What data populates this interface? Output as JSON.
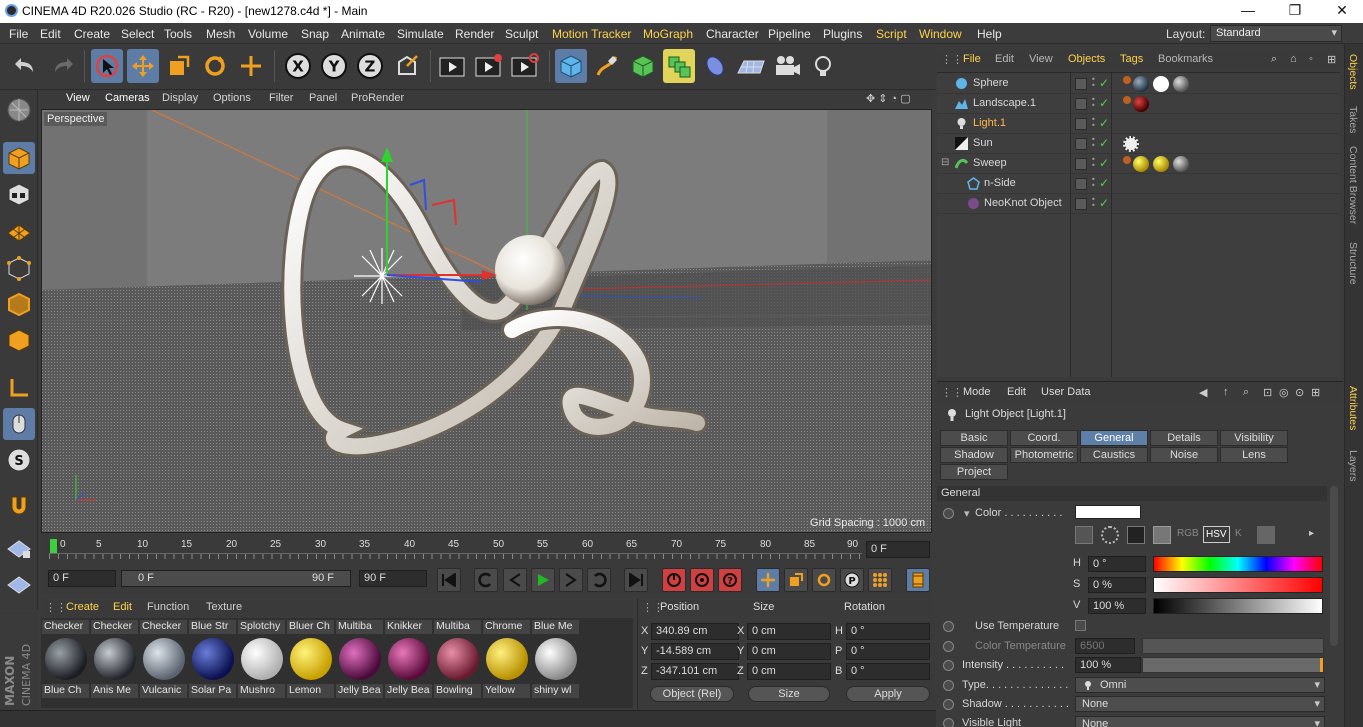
{
  "window": {
    "title": "CINEMA 4D R20.026 Studio (RC - R20) - [new1278.c4d *] - Main",
    "minimize": "—",
    "restore": "❐",
    "close": "✕"
  },
  "menubar": {
    "items": [
      "File",
      "Edit",
      "Create",
      "Select",
      "Tools",
      "Mesh",
      "Volume",
      "Snap",
      "Animate",
      "Simulate",
      "Render",
      "Sculpt",
      "Motion Tracker",
      "MoGraph",
      "Character",
      "Pipeline",
      "Plugins",
      "Script",
      "Window",
      "Help"
    ],
    "layout_label": "Layout:",
    "layout_value": "Standard"
  },
  "viewport": {
    "menu": [
      "View",
      "Cameras",
      "Display",
      "Options",
      "Filter",
      "Panel",
      "ProRender"
    ],
    "camera_label": "Perspective",
    "grid_spacing": "Grid Spacing : 1000 cm"
  },
  "timeline": {
    "ticks": [
      "0",
      "5",
      "10",
      "15",
      "20",
      "25",
      "30",
      "35",
      "40",
      "45",
      "50",
      "55",
      "60",
      "65",
      "70",
      "75",
      "80",
      "85",
      "90"
    ],
    "current_frame": "0 F"
  },
  "transport": {
    "start": "0 F",
    "range_start": "0 F",
    "range_end": "90 F",
    "end": "90 F"
  },
  "material_manager": {
    "menu": [
      "Create",
      "Edit",
      "Function",
      "Texture"
    ],
    "row1": [
      "Checker",
      "Checker",
      "Checker",
      "Blue Str",
      "Splotchy",
      "Bluer Ch",
      "Multiba",
      "Knikker",
      "Multiba",
      "Chrome",
      "Blue Me"
    ],
    "row2": [
      "Blue Ch",
      "Anis Me",
      "Vulcanic",
      "Solar Pa",
      "Mushro",
      "Lemon",
      "Jelly Bea",
      "Jelly Bea",
      "Bowling",
      "Yellow",
      "shiny wl"
    ]
  },
  "coordinates": {
    "headers": [
      "Position",
      "Size",
      "Rotation"
    ],
    "position": {
      "x": "340.89 cm",
      "y": "-14.589 cm",
      "z": "-347.101 cm"
    },
    "size": {
      "x": "0 cm",
      "y": "0 cm",
      "z": "0 cm"
    },
    "rotation": {
      "h": "0 °",
      "p": "0 °",
      "b": "0 °"
    },
    "axis_labels": {
      "x": "X",
      "y": "Y",
      "z": "Z",
      "h": "H",
      "p": "P",
      "b": "B"
    },
    "mode": "Object (Rel)",
    "size_mode": "Size",
    "apply": "Apply"
  },
  "object_manager": {
    "menu": [
      "File",
      "Edit",
      "View",
      "Objects",
      "Tags",
      "Bookmarks"
    ],
    "objects": [
      {
        "name": "Sphere"
      },
      {
        "name": "Landscape.1"
      },
      {
        "name": "Light.1"
      },
      {
        "name": "Sun"
      },
      {
        "name": "Sweep"
      },
      {
        "name": "n-Side"
      },
      {
        "name": "NeoKnot Object"
      }
    ]
  },
  "attributes": {
    "menu": [
      "Mode",
      "Edit",
      "User Data"
    ],
    "title": "Light Object [Light.1]",
    "tabs_row1": [
      "Basic",
      "Coord.",
      "General",
      "Details",
      "Visibility"
    ],
    "tabs_row2": [
      "Shadow",
      "Photometric",
      "Caustics",
      "Noise",
      "Lens"
    ],
    "tabs_row3": [
      "Project"
    ],
    "section": "General",
    "color_label": "Color . . . . . . . . . .",
    "h_label": "H",
    "h_value": "0 °",
    "s_label": "S",
    "s_value": "0 %",
    "v_label": "V",
    "v_value": "100 %",
    "mode_rgb": "RGB",
    "mode_hsv": "HSV",
    "mode_k": "K",
    "use_temperature": "Use Temperature",
    "color_temperature": "Color Temperature",
    "color_temperature_value": "6500",
    "intensity_label": "Intensity . . . . . . . . . .",
    "intensity_value": "100 %",
    "type_label": "Type. . . . . . . . . . . . . .",
    "type_value": "Omni",
    "shadow_label": "Shadow . . . . . . . . . . .",
    "shadow_value": "None",
    "visible_light_label": "Visible Light",
    "visible_light_value": "None"
  },
  "side_tabs": [
    "Objects",
    "Takes",
    "Content Browser",
    "Structure",
    "Attributes",
    "Layers"
  ],
  "colors": {
    "accent": "#ffd24d",
    "selection": "#5d7da6",
    "check": "#4ed24e"
  }
}
